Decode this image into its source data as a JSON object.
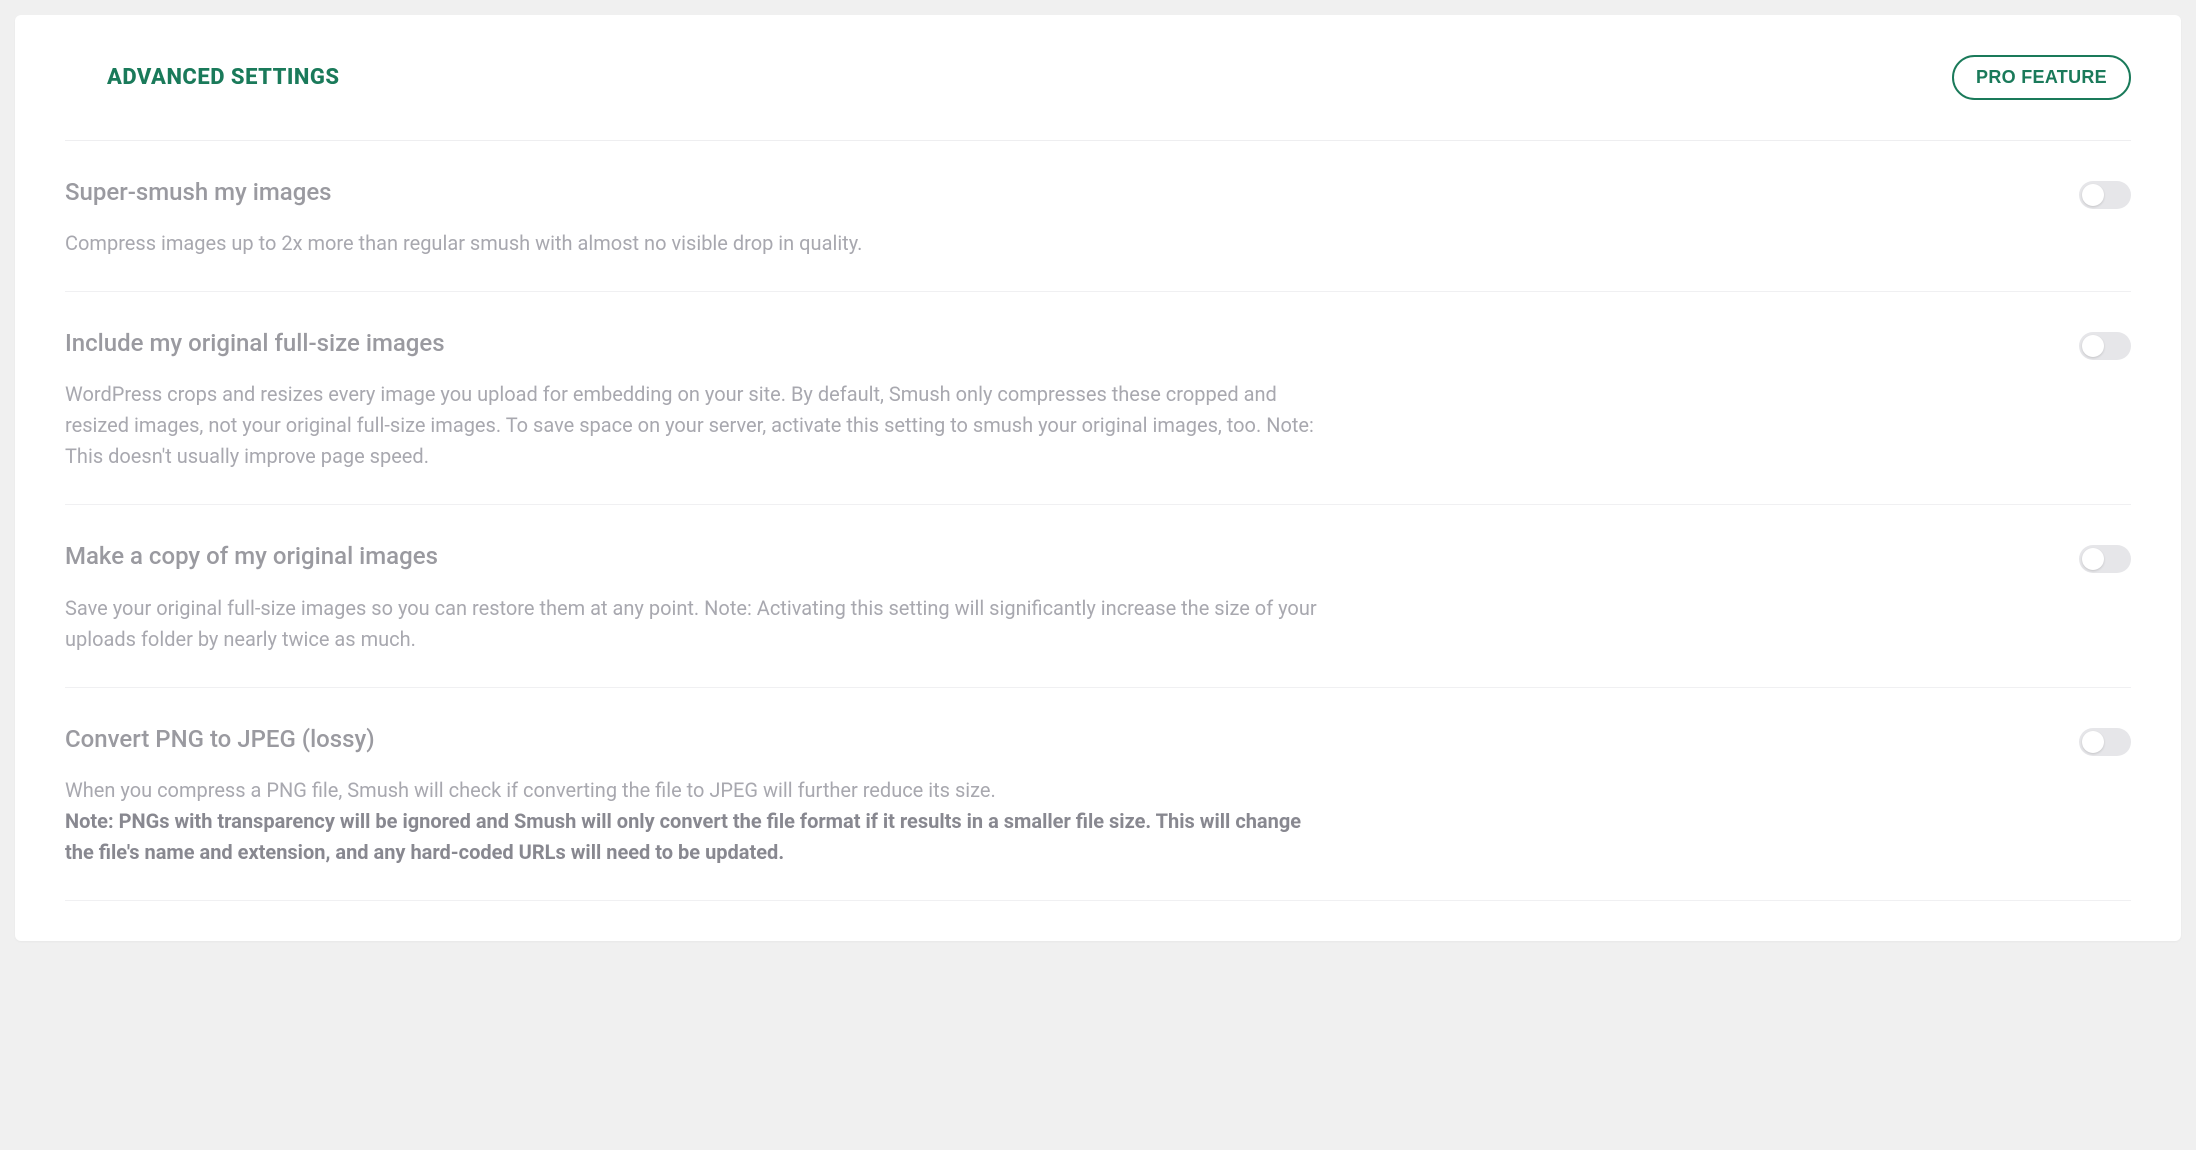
{
  "header": {
    "title": "ADVANCED SETTINGS",
    "pro_label": "PRO FEATURE"
  },
  "settings": {
    "super_smush": {
      "title": "Super-smush my images",
      "desc": "Compress images up to 2x more than regular smush with almost no visible drop in quality."
    },
    "include_original": {
      "title": "Include my original full-size images",
      "desc": "WordPress crops and resizes every image you upload for embedding on your site. By default, Smush only compresses these cropped and resized images, not your original full-size images. To save space on your server, activate this setting to smush your original images, too. Note: This doesn't usually improve page speed."
    },
    "make_copy": {
      "title": "Make a copy of my original images",
      "desc": "Save your original full-size images so you can restore them at any point. Note: Activating this setting will significantly increase the size of your uploads folder by nearly twice as much."
    },
    "convert_png": {
      "title": "Convert PNG to JPEG (lossy)",
      "desc_line1": "When you compress a PNG file, Smush will check if converting the file to JPEG will further reduce its size.",
      "desc_note": "Note: PNGs with transparency will be ignored and Smush will only convert the file format if it results in a smaller file size. This will change the file's name and extension, and any hard-coded URLs will need to be updated."
    }
  }
}
